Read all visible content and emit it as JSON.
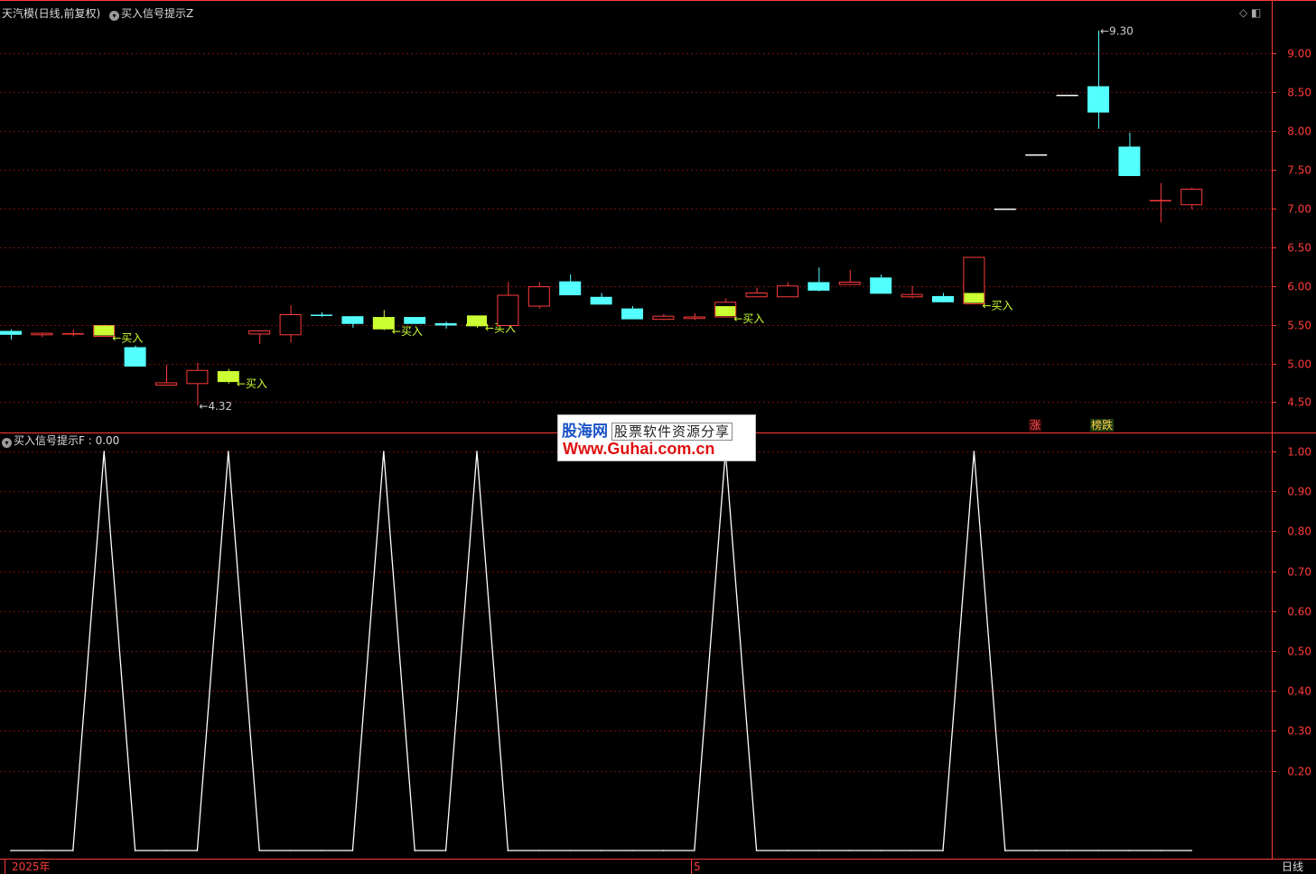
{
  "header": {
    "stock_title": "天汽模(日线,前复权)",
    "indicator_main": "买入信号提示Z",
    "indicator_sub": "买入信号提示F : 0.00",
    "corner_icons": "◇ ◧"
  },
  "watermark": {
    "brand": "股海网",
    "slogan": "股票软件资源分享",
    "url": "Www.Guhai.com.cn"
  },
  "tags": {
    "up": "涨",
    "down": "榜跌"
  },
  "footer": {
    "period_label": "日线"
  },
  "colors": {
    "up": "#ff3b3b",
    "down": "#54ffff",
    "signal": "#ccff33",
    "grid": "#7a1010",
    "axis": "#ff3b3b"
  },
  "chart_data": [
    {
      "type": "candlestick",
      "title": "天汽模(日线,前复权)",
      "ylim": [
        4.12,
        9.6
      ],
      "yticks": [
        "9.00",
        "8.50",
        "8.00",
        "7.50",
        "7.00",
        "6.50",
        "6.00",
        "5.50",
        "5.00",
        "4.50"
      ],
      "annotations": [
        {
          "text": "9.30",
          "label": "max-high"
        },
        {
          "text": "4.32",
          "label": "min-low"
        }
      ],
      "signal_label": "买入",
      "candles": [
        {
          "o": 5.42,
          "h": 5.44,
          "l": 5.31,
          "c": 5.37
        },
        {
          "o": 5.37,
          "h": 5.4,
          "l": 5.34,
          "c": 5.39
        },
        {
          "o": 5.39,
          "h": 5.44,
          "l": 5.35,
          "c": 5.39
        },
        {
          "o": 5.35,
          "h": 5.5,
          "l": 5.34,
          "c": 5.49,
          "signal": true
        },
        {
          "o": 5.21,
          "h": 5.23,
          "l": 4.96,
          "c": 4.96
        },
        {
          "o": 4.72,
          "h": 4.98,
          "l": 4.72,
          "c": 4.75
        },
        {
          "o": 4.74,
          "h": 5.01,
          "l": 4.46,
          "c": 4.91
        },
        {
          "o": 4.9,
          "h": 4.93,
          "l": 4.74,
          "c": 4.76,
          "signal": true
        },
        {
          "o": 5.38,
          "h": 5.43,
          "l": 5.25,
          "c": 5.42
        },
        {
          "o": 5.37,
          "h": 5.75,
          "l": 5.27,
          "c": 5.63
        },
        {
          "o": 5.63,
          "h": 5.66,
          "l": 5.6,
          "c": 5.62
        },
        {
          "o": 5.61,
          "h": 5.61,
          "l": 5.46,
          "c": 5.51
        },
        {
          "o": 5.6,
          "h": 5.69,
          "l": 5.43,
          "c": 5.44,
          "signal": true
        },
        {
          "o": 5.6,
          "h": 5.6,
          "l": 5.51,
          "c": 5.51
        },
        {
          "o": 5.52,
          "h": 5.54,
          "l": 5.45,
          "c": 5.49
        },
        {
          "o": 5.51,
          "h": 5.53,
          "l": 5.46,
          "c": 5.48,
          "signal": true
        },
        {
          "o": 5.49,
          "h": 6.05,
          "l": 5.49,
          "c": 5.88
        },
        {
          "o": 5.74,
          "h": 6.05,
          "l": 5.71,
          "c": 5.99
        },
        {
          "o": 6.06,
          "h": 6.15,
          "l": 5.88,
          "c": 5.88
        },
        {
          "o": 5.86,
          "h": 5.91,
          "l": 5.76,
          "c": 5.76
        },
        {
          "o": 5.71,
          "h": 5.74,
          "l": 5.57,
          "c": 5.57
        },
        {
          "o": 5.57,
          "h": 5.64,
          "l": 5.56,
          "c": 5.61
        },
        {
          "o": 5.58,
          "h": 5.65,
          "l": 5.56,
          "c": 5.6
        },
        {
          "o": 5.6,
          "h": 5.84,
          "l": 5.59,
          "c": 5.79,
          "signal": true
        },
        {
          "o": 5.86,
          "h": 5.98,
          "l": 5.86,
          "c": 5.91
        },
        {
          "o": 5.86,
          "h": 6.05,
          "l": 5.86,
          "c": 6.0
        },
        {
          "o": 6.05,
          "h": 6.24,
          "l": 5.93,
          "c": 5.94
        },
        {
          "o": 6.02,
          "h": 6.21,
          "l": 6.02,
          "c": 6.05
        },
        {
          "o": 6.11,
          "h": 6.15,
          "l": 5.91,
          "c": 5.9
        },
        {
          "o": 5.86,
          "h": 6.0,
          "l": 5.84,
          "c": 5.89
        },
        {
          "o": 5.87,
          "h": 5.91,
          "l": 5.79,
          "c": 5.79
        },
        {
          "o": 5.77,
          "h": 6.37,
          "l": 5.77,
          "c": 6.37,
          "signal": true
        },
        {
          "o": 7.0,
          "h": 7.0,
          "l": 7.0,
          "c": 7.0
        },
        {
          "o": 7.7,
          "h": 7.7,
          "l": 7.7,
          "c": 7.7
        },
        {
          "o": 8.47,
          "h": 8.47,
          "l": 8.47,
          "c": 8.47
        },
        {
          "o": 8.58,
          "h": 9.3,
          "l": 8.03,
          "c": 8.24
        },
        {
          "o": 7.8,
          "h": 7.98,
          "l": 7.42,
          "c": 7.42
        },
        {
          "o": 7.11,
          "h": 7.33,
          "l": 6.82,
          "c": 7.11
        },
        {
          "o": 7.05,
          "h": 7.27,
          "l": 6.99,
          "c": 7.25
        }
      ]
    },
    {
      "type": "line",
      "title": "买入信号提示F",
      "ylim": [
        0.0,
        1.0
      ],
      "yticks": [
        "1.00",
        "0.90",
        "0.80",
        "0.70",
        "0.60",
        "0.50",
        "0.40",
        "0.30",
        "0.20"
      ],
      "x_labels": [
        "2025年",
        "5"
      ],
      "values": [
        0,
        0,
        0,
        1,
        0,
        0,
        0,
        1,
        0,
        0,
        0,
        0,
        1,
        0,
        0,
        1,
        0,
        0,
        0,
        0,
        0,
        0,
        0,
        1,
        0,
        0,
        0,
        0,
        0,
        0,
        0,
        1,
        0,
        0,
        0,
        0,
        0,
        0,
        0
      ]
    }
  ]
}
